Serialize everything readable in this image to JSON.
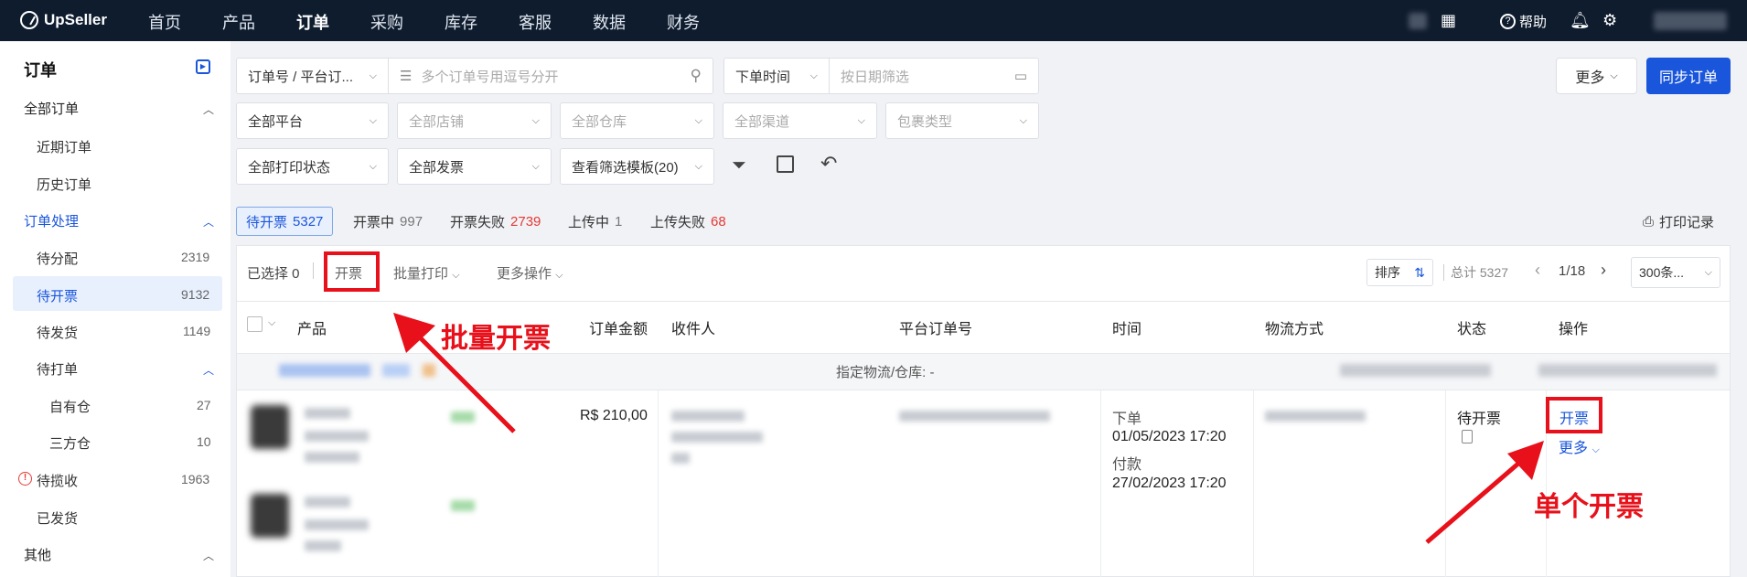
{
  "topnav": {
    "logo": "UpSeller",
    "items": [
      "首页",
      "产品",
      "订单",
      "采购",
      "库存",
      "客服",
      "数据",
      "财务"
    ],
    "help": "帮助"
  },
  "sidebar": {
    "title": "订单",
    "all_orders": "全部订单",
    "recent": "近期订单",
    "history": "历史订单",
    "processing": "订单处理",
    "to_allocate": "待分配",
    "to_allocate_count": "2319",
    "to_invoice": "待开票",
    "to_invoice_count": "9132",
    "to_ship": "待发货",
    "to_ship_count": "1149",
    "to_print": "待打单",
    "own_wh": "自有仓",
    "own_wh_count": "27",
    "third_wh": "三方仓",
    "third_wh_count": "10",
    "to_collect": "待揽收",
    "to_collect_count": "1963",
    "shipped": "已发货",
    "other": "其他"
  },
  "filters": {
    "order_no": "订单号 / 平台订...",
    "order_no_ph": "多个订单号用逗号分开",
    "order_time": "下单时间",
    "date_ph": "按日期筛选",
    "platform": "全部平台",
    "store": "全部店铺",
    "warehouse": "全部仓库",
    "channel": "全部渠道",
    "package": "包裹类型",
    "print_status": "全部打印状态",
    "invoice": "全部发票",
    "template": "查看筛选模板(20)",
    "more": "更多",
    "sync": "同步订单"
  },
  "tabs": [
    {
      "label": "待开票",
      "count": "5327"
    },
    {
      "label": "开票中",
      "count": "997"
    },
    {
      "label": "开票失败",
      "count": "2739"
    },
    {
      "label": "上传中",
      "count": "1"
    },
    {
      "label": "上传失败",
      "count": "68"
    }
  ],
  "print_record": "打印记录",
  "toolbar": {
    "selected": "已选择 0",
    "invoice": "开票",
    "batch_print": "批量打印",
    "more_ops": "更多操作",
    "sort": "排序",
    "total": "总计 5327",
    "page": "1/18",
    "per_page": "300条..."
  },
  "columns": [
    "产品",
    "订单金额",
    "收件人",
    "平台订单号",
    "时间",
    "物流方式",
    "状态",
    "操作"
  ],
  "group_row": "指定物流/仓库: -",
  "row": {
    "amount": "R$ 210,00",
    "time_order_label": "下单",
    "time_order": "01/05/2023 17:20",
    "time_pay_label": "付款",
    "time_pay": "27/02/2023 17:20",
    "status": "待开票",
    "op_invoice": "开票",
    "op_more": "更多"
  },
  "annotations": {
    "batch": "批量开票",
    "single": "单个开票"
  },
  "colors": {
    "accent": "#1a56db",
    "nav": "#0f1c2e",
    "annotation": "#e8101a"
  }
}
